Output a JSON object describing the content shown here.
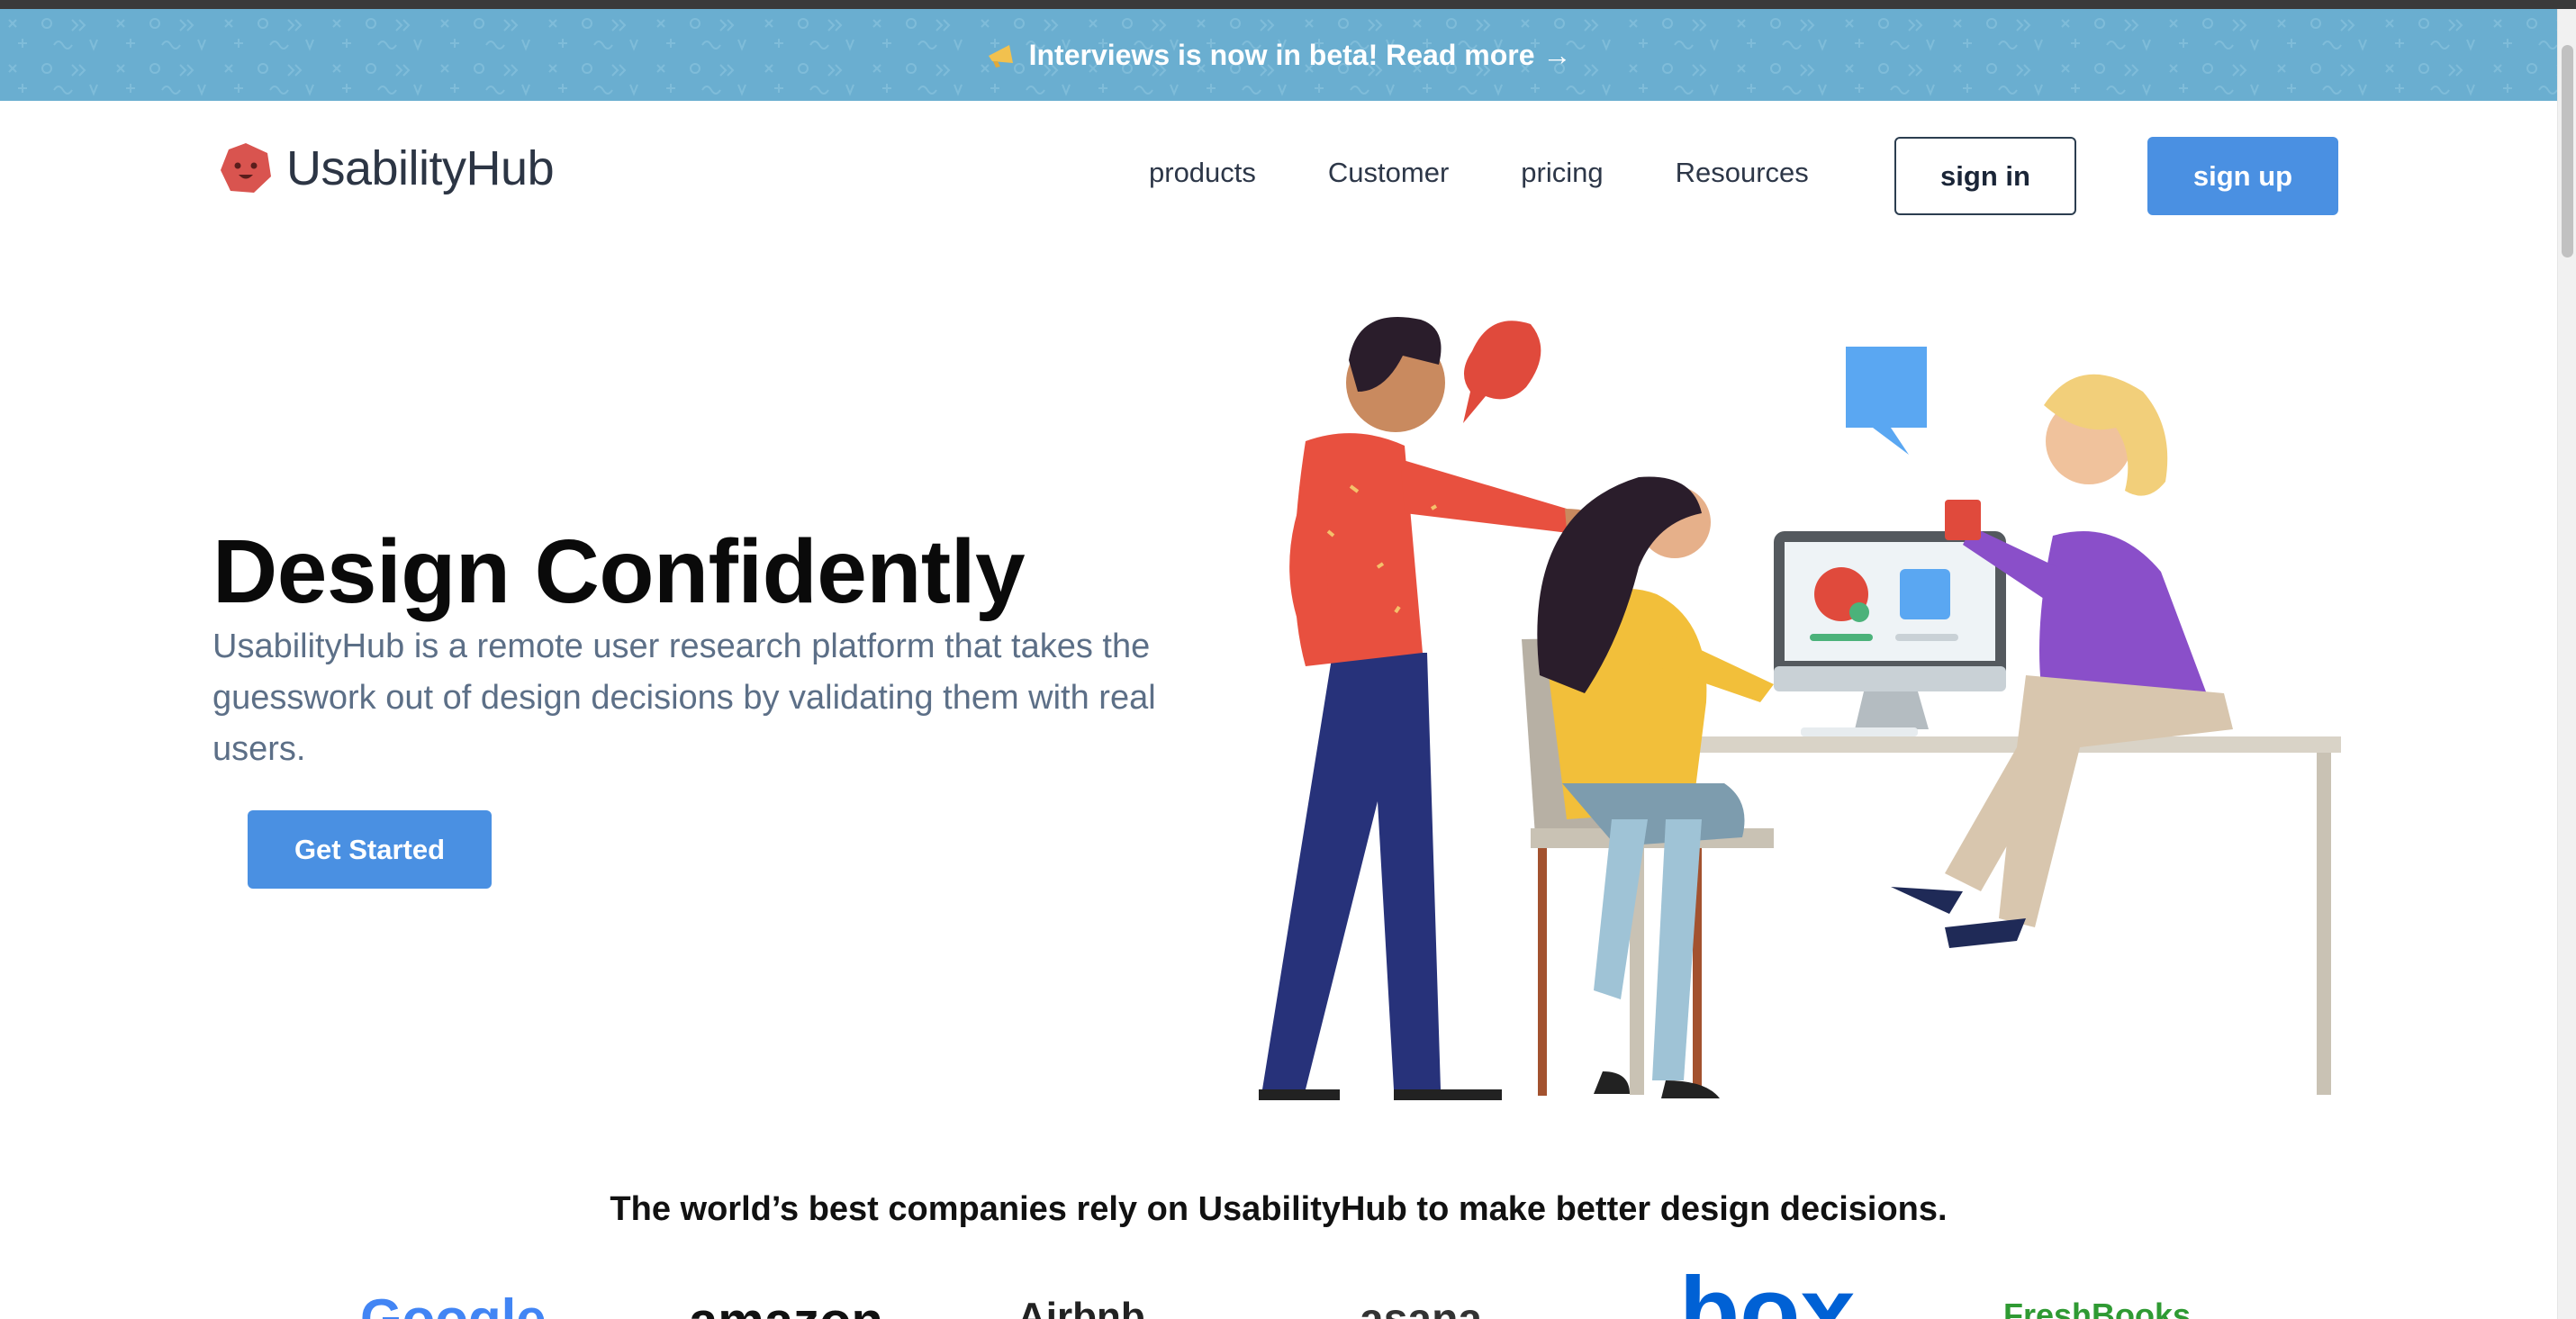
{
  "banner": {
    "icon": "megaphone-icon",
    "text": "Interviews is now in beta! Read more →",
    "bg_color": "#6aaed0"
  },
  "nav": {
    "logo_text": "UsabilityHub",
    "links": [
      "products",
      "Customer",
      "pricing",
      "Resources"
    ],
    "sign_in": "sign in",
    "sign_up": "sign up"
  },
  "hero": {
    "title": "Design Confidently",
    "subtitle": "UsabilityHub is a remote user research platform that takes the guesswork out of design decisions by validating them with real users.",
    "cta": "Get Started"
  },
  "trust": {
    "headline": "The world’s best companies rely on UsabilityHub to make better design decisions.",
    "logos": [
      "Google",
      "amazon",
      "Airbnb",
      "asana",
      "box",
      "FreshBooks"
    ]
  },
  "colors": {
    "accent": "#4a90e2",
    "logo_red": "#d9544f",
    "text_muted": "#5c6f87"
  }
}
